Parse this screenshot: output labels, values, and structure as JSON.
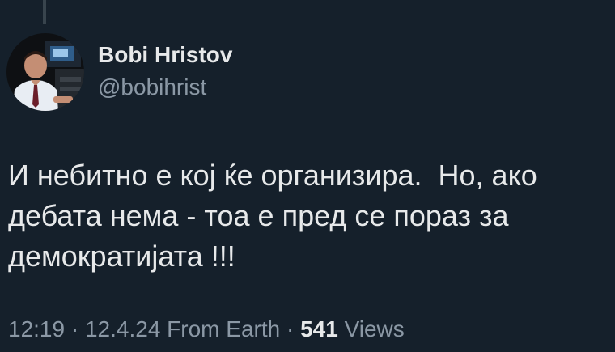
{
  "author": {
    "display_name": "Bobi Hristov",
    "handle": "@bobihrist"
  },
  "tweet": {
    "text": "И небитно е кој ќе организира.  Но, ако\nдебата нема - тоа е пред се пораз за\nдемократијата !!!"
  },
  "meta": {
    "time": "12:19",
    "separator": " · ",
    "date": "12.4.24",
    "source": " From Earth",
    "views_count": "541",
    "views_label": " Views"
  },
  "colors": {
    "background": "#15202b",
    "primary_text": "#e7e9ea",
    "secondary_text": "#8b98a5",
    "thread_line": "#38444d"
  }
}
